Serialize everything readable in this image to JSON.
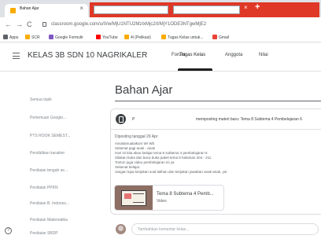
{
  "browser": {
    "tab_title": "Bahan Ajar",
    "tab_close": "×",
    "red_close": "×",
    "new_tab": "+",
    "url": "classroom.google.com/u/0/w/MjU1NTU2MzIxMjc2/t/MjY1ODE3NTgwMjE2"
  },
  "nav": {
    "back": "←",
    "forward": "→",
    "reload": "C",
    "home": "⌂"
  },
  "bookmarks": [
    {
      "label": "Apps",
      "color": "#5f6368"
    },
    {
      "label": "SCR",
      "color": "#f9ab00"
    },
    {
      "label": "Google Formulir",
      "color": "#7e57c2"
    },
    {
      "label": "YouTube",
      "color": "#ff0000"
    },
    {
      "label": "4i (Pelikasi)",
      "color": "#f9ab00"
    },
    {
      "label": "Tugas Kelas untuk...",
      "color": "#f9ab00"
    },
    {
      "label": "Gmail",
      "color": "#ea4335"
    }
  ],
  "classroom": {
    "class_title": "KELAS 3B SDN 10 NAGRIKALER",
    "tabs": [
      "Forum",
      "Tugas Kelas",
      "Anggota",
      "Nilai"
    ]
  },
  "sidebar": {
    "items": [
      "Semua topik",
      "Pertemuan Google...",
      "PTS ROOK SEMEST...",
      "Pendidikan karakter",
      "Penilaian tengah se...",
      "Penilaian PPKN",
      "Penilaian B. Indones...",
      "Penilaian Matematika",
      "Penilaian SBDP"
    ],
    "help": "?"
  },
  "main": {
    "topic_title": "Bahan Ajar",
    "post": {
      "author": "P",
      "headline": "memposting materi baru: Tema 8 Subtema 4 Pembelajaran 6",
      "date": "Diposting tanggal 29 Apr",
      "body": [
        "Assalamualaikum Wr Wb",
        "Selamat pagi anak - anak",
        "Hari ini kita akan belajar tema 8 subtema 4 pembelajaran 6",
        "Silakan buka dan baca buka paket tema 8 halaman 204 - 211.",
        "Tonton juga video pembelajaran ini ya",
        "Selamat belajar.",
        "Jangan lupa kerjakan soal latihan dan kerjakan jawaban anak-anak, ya!"
      ],
      "attachment": {
        "title": "Tema 8 Subtema 4 Pemb...",
        "type": "Video"
      }
    },
    "comment_placeholder": "Tambahkan komentar kelas..."
  }
}
